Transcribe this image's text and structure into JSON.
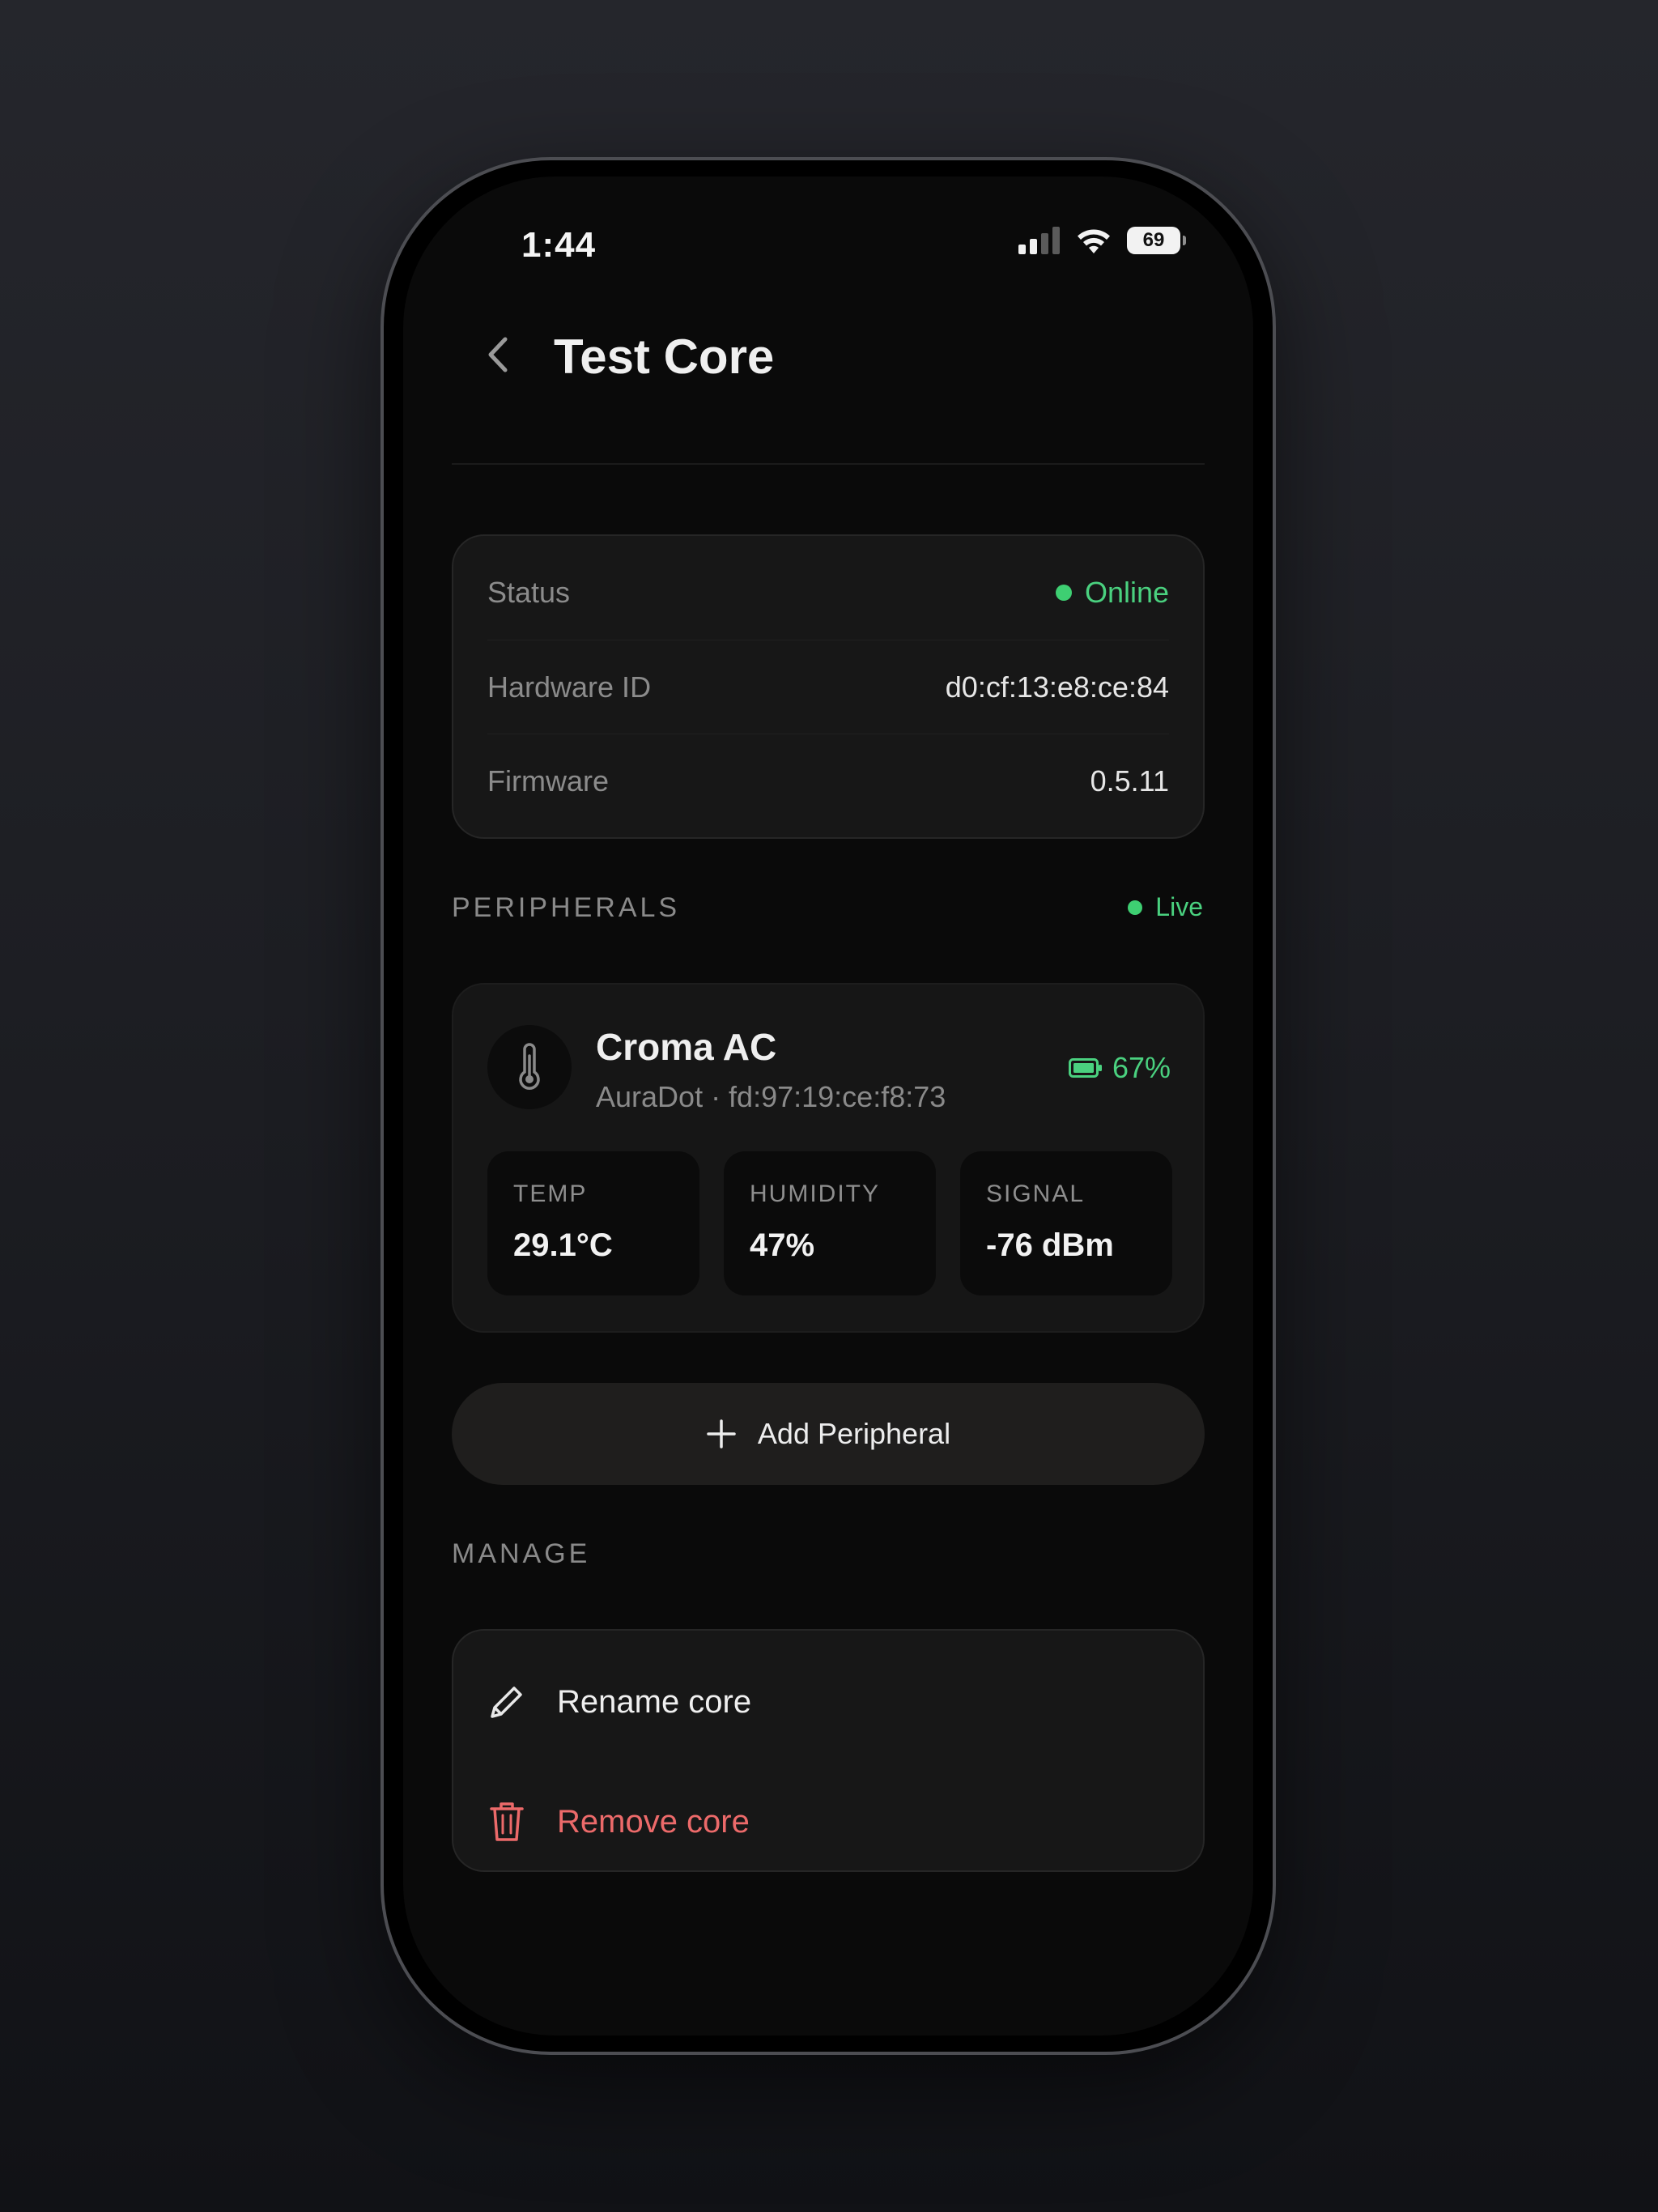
{
  "status_bar": {
    "time": "1:44",
    "battery_level": "69",
    "icons": [
      "cellular-signal-icon",
      "wifi-icon",
      "battery-icon"
    ]
  },
  "header": {
    "title": "Test Core",
    "back_icon": "chevron-left-icon"
  },
  "info": {
    "status_label": "Status",
    "status_value": "Online",
    "hardware_label": "Hardware ID",
    "hardware_value": "d0:cf:13:e8:ce:84",
    "firmware_label": "Firmware",
    "firmware_value": "0.5.11"
  },
  "peripherals": {
    "section_label": "PERIPHERALS",
    "live_label": "Live",
    "items": [
      {
        "icon": "thermometer-icon",
        "name": "Croma AC",
        "subtitle": "AuraDot · fd:97:19:ce:f8:73",
        "battery": "67%",
        "metrics": [
          {
            "label": "TEMP",
            "value": "29.1°C"
          },
          {
            "label": "HUMIDITY",
            "value": "47%"
          },
          {
            "label": "SIGNAL",
            "value": "-76 dBm"
          }
        ]
      }
    ],
    "add_button": "Add Peripheral"
  },
  "manage": {
    "section_label": "MANAGE",
    "rename_label": "Rename core",
    "remove_label": "Remove core"
  },
  "colors": {
    "accent_green": "#4ad17f",
    "danger_red": "#ec6a6a",
    "background": "#0a0a0a",
    "card": "#171717"
  }
}
